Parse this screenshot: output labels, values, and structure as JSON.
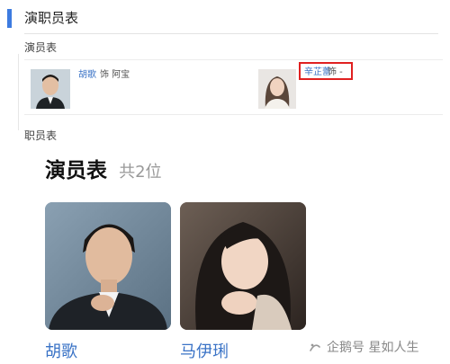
{
  "section": {
    "title": "演职员表",
    "cast_label": "演员表",
    "crew_label": "职员表",
    "cast": [
      {
        "actor": "胡歌",
        "role": "饰 阿宝"
      },
      {
        "actor": "辛芷蕾",
        "role": "饰 -"
      }
    ]
  },
  "cast_panel": {
    "title": "演员表",
    "count": "共2位",
    "cards": [
      {
        "name": "胡歌"
      },
      {
        "name": "马伊琍"
      }
    ]
  },
  "watermark": {
    "text": "企鹅号 星如人生"
  },
  "colors": {
    "accent": "#3d7be0",
    "link": "#3a73c6",
    "highlight_border": "#e02020"
  }
}
